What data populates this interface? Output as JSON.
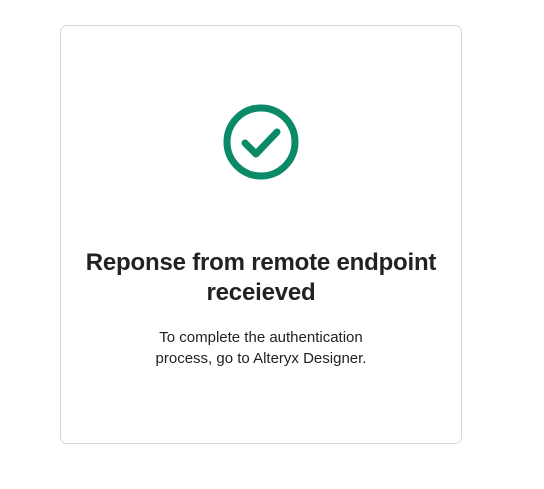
{
  "card": {
    "title": "Reponse from remote endpoint receieved",
    "message": "To complete the authentication process, go to Alteryx Designer."
  },
  "icons": {
    "status": "check-circle-icon"
  },
  "colors": {
    "success": "#0b8a68",
    "text": "#222222",
    "border": "#d7d7d7",
    "background": "#ffffff"
  }
}
